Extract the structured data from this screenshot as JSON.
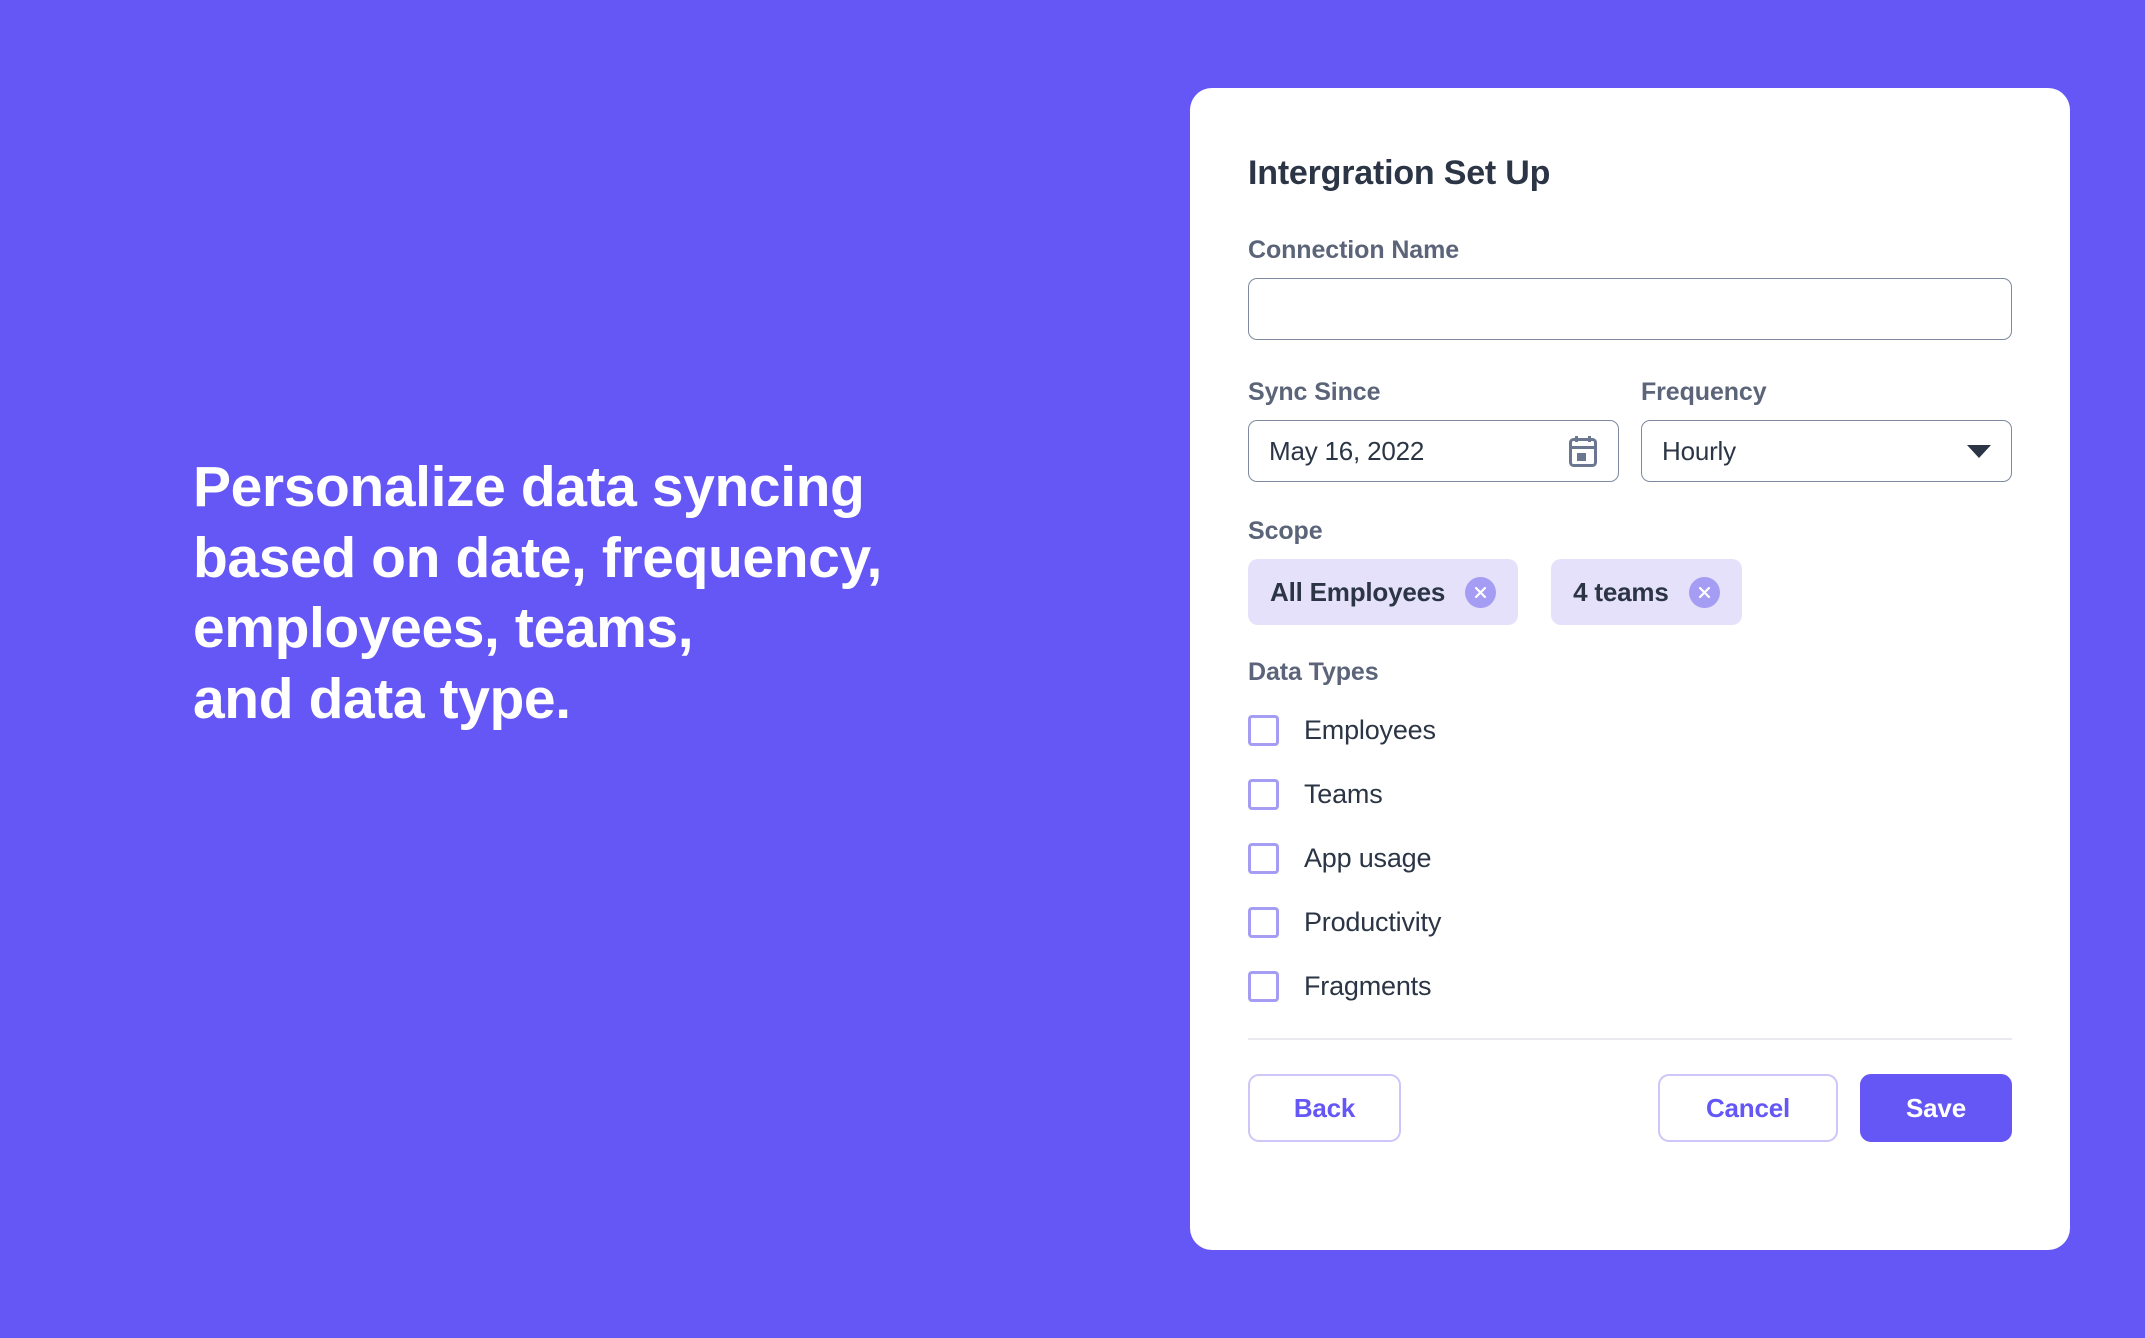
{
  "theme": {
    "background": "#6457f5",
    "accent": "#6457f5",
    "chip_background": "#e5e1fa",
    "chip_close_background": "#a59cf3",
    "checkbox_border": "#a59cf3",
    "card_background": "#ffffff",
    "label_color": "#5b6478",
    "value_color": "#2b3545",
    "input_border": "#7e8a9f"
  },
  "promo": {
    "headline": "Personalize data syncing\nbased on date, frequency,\nemployees, teams,\nand data type."
  },
  "card": {
    "title": "Intergration Set Up",
    "connection": {
      "label": "Connection Name",
      "value": "",
      "placeholder": ""
    },
    "sync_since": {
      "label": "Sync Since",
      "value": "May 16, 2022",
      "icon": "calendar-icon"
    },
    "frequency": {
      "label": "Frequency",
      "value": "Hourly",
      "icon": "chevron-down-icon",
      "options": [
        "Hourly"
      ]
    },
    "scope": {
      "label": "Scope",
      "chips": [
        {
          "label": "All Employees",
          "remove_icon": "close-circle-icon"
        },
        {
          "label": "4 teams",
          "remove_icon": "close-circle-icon"
        }
      ]
    },
    "data_types": {
      "label": "Data Types",
      "items": [
        {
          "label": "Employees",
          "checked": false
        },
        {
          "label": "Teams",
          "checked": false
        },
        {
          "label": "App usage",
          "checked": false
        },
        {
          "label": "Productivity",
          "checked": false
        },
        {
          "label": "Fragments",
          "checked": false
        }
      ]
    },
    "footer": {
      "back_label": "Back",
      "cancel_label": "Cancel",
      "save_label": "Save"
    }
  }
}
